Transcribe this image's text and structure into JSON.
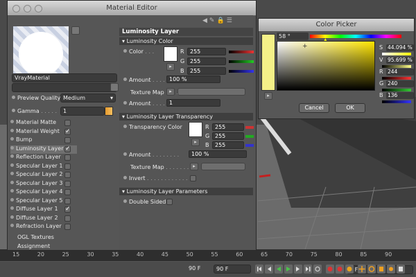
{
  "editor": {
    "title": "Material Editor",
    "material_name": "VrayMaterial",
    "preview_quality_label": "Preview Quality",
    "preview_quality_value": "Medium",
    "gamma_label": "Gamma",
    "gamma_value": "1",
    "layers": [
      {
        "label": "Material Matte",
        "checked": false
      },
      {
        "label": "Material Weight",
        "checked": true
      },
      {
        "label": "Bump",
        "checked": false
      },
      {
        "label": "Luminosity Layer",
        "checked": true,
        "selected": true
      },
      {
        "label": "Reflection Layer",
        "checked": false
      },
      {
        "label": "Specular Layer 1",
        "checked": false
      },
      {
        "label": "Specular Layer 2",
        "checked": false
      },
      {
        "label": "Specular Layer 3",
        "checked": false
      },
      {
        "label": "Specular Layer 4",
        "checked": false
      },
      {
        "label": "Specular Layer 5",
        "checked": false
      },
      {
        "label": "Diffuse Layer 1",
        "checked": true
      },
      {
        "label": "Diffuse Layer 2",
        "checked": false
      },
      {
        "label": "Refraction Layer",
        "checked": false
      }
    ],
    "ogl_textures": "OGL Textures",
    "assignment": "Assignment"
  },
  "luminosity": {
    "header": "Luminosity Layer",
    "color_section": "Luminosity Color",
    "color_label": "Color",
    "r_label": "R",
    "g_label": "G",
    "b_label": "B",
    "r": "255",
    "g": "255",
    "b": "255",
    "amount_label": "Amount",
    "amount_value": "100 %",
    "texture_map_label": "Texture Map",
    "amount2_label": "Amount",
    "amount2_value": "1"
  },
  "transparency": {
    "section": "Luminosity Layer Transparency",
    "color_label": "Transparency Color",
    "r": "255",
    "g": "255",
    "b": "255",
    "r_label": "R",
    "g_label": "G",
    "b_label": "B",
    "amount_label": "Amount",
    "amount_value": "100 %",
    "texture_map_label": "Texture Map",
    "invert_label": "Invert"
  },
  "parameters": {
    "section": "Luminosity Layer Parameters",
    "double_sided_label": "Double Sided"
  },
  "picker": {
    "title": "Color Picker",
    "hue_value": "58 °",
    "s_label": "S",
    "s_value": "44.094 %",
    "v_label": "V",
    "v_value": "95.699 %",
    "r_label": "R",
    "r_value": "244",
    "g_label": "G",
    "g_value": "240",
    "b_label": "B",
    "b_value": "136",
    "cancel_label": "Cancel",
    "ok_label": "OK",
    "selected_color": "#f4f088"
  },
  "timeline": {
    "ticks": [
      "15",
      "20",
      "25",
      "30",
      "35",
      "40",
      "45",
      "50",
      "55",
      "60",
      "65",
      "70",
      "75",
      "80",
      "85",
      "90"
    ],
    "frame_current": "0 F",
    "frame_start": "90 F",
    "frame_end": "90 F"
  }
}
